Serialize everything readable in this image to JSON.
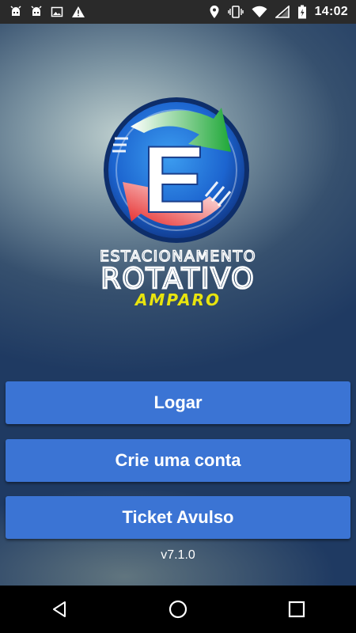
{
  "status_bar": {
    "time": "14:02",
    "left_icons": [
      "android-icon",
      "android-icon",
      "image-icon",
      "warning-icon"
    ],
    "right_icons": [
      "location-icon",
      "vibrate-icon",
      "wifi-icon",
      "signal-icon",
      "battery-icon"
    ]
  },
  "logo": {
    "letter": "E",
    "line1": "ESTACIONAMENTO",
    "line2": "ROTATIVO",
    "line3": "AMPARO"
  },
  "buttons": {
    "login": "Logar",
    "create_account": "Crie uma conta",
    "ticket": "Ticket Avulso"
  },
  "version": "v7.1.0",
  "colors": {
    "button": "#3b74d4",
    "logo_circle": "#1f6fd6",
    "logo_green": "#22a83a",
    "logo_red": "#e52b2b",
    "logo_yellow": "#e8e40e"
  }
}
